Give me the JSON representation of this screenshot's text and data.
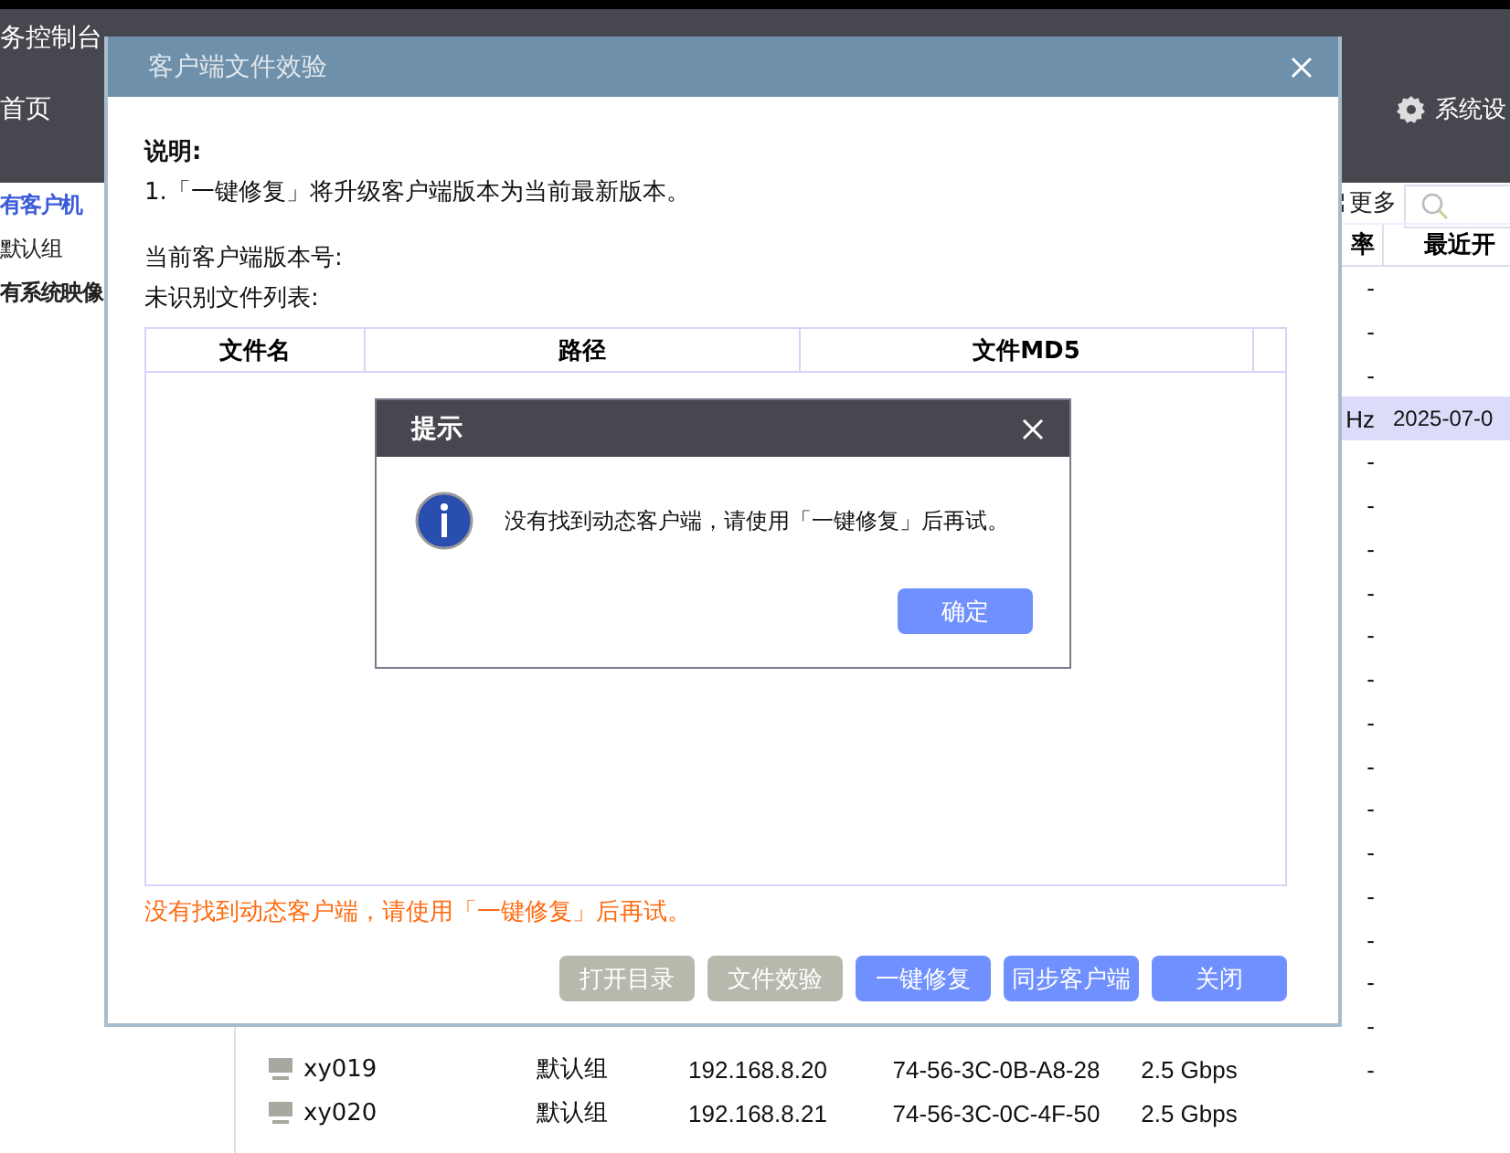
{
  "app": {
    "title": "务控制台",
    "nav": [
      {
        "label": "首页",
        "selected": false
      }
    ],
    "settings": "系统设"
  },
  "sidebar": {
    "items": [
      {
        "label": "有客户机",
        "kind": "selected"
      },
      {
        "label": "默认组",
        "kind": "plain"
      },
      {
        "label": "有系统映像",
        "kind": "heading"
      }
    ]
  },
  "toolbar": {
    "more": "更多"
  },
  "table": {
    "columns": [
      {
        "label": "率"
      },
      {
        "label": "最近开"
      }
    ],
    "rows": [
      {
        "rate": "-",
        "selected": false
      },
      {
        "rate": "-",
        "selected": false
      },
      {
        "rate": "-",
        "selected": false
      },
      {
        "rate": "Hz",
        "last": "2025-07-0",
        "selected": true
      },
      {
        "rate": "-",
        "selected": false
      },
      {
        "rate": "-",
        "selected": false
      },
      {
        "rate": "-",
        "selected": false
      },
      {
        "rate": "-",
        "selected": false
      },
      {
        "rate": "-",
        "selected": false
      },
      {
        "rate": "-",
        "selected": false
      },
      {
        "rate": "-",
        "selected": false
      },
      {
        "rate": "-",
        "selected": false
      },
      {
        "rate": "-",
        "selected": false
      },
      {
        "rate": "-",
        "selected": false
      },
      {
        "rate": "-",
        "selected": false
      },
      {
        "rate": "-",
        "selected": false
      },
      {
        "rate": "-",
        "selected": false
      },
      {
        "rate": "-",
        "selected": false
      },
      {
        "name": "xy019",
        "group": "默认组",
        "ip": "192.168.8.20",
        "mac": "74-56-3C-0B-A8-28",
        "speed": "2.5 Gbps",
        "rate": "-",
        "selected": false
      },
      {
        "name": "xy020",
        "group": "默认组",
        "ip": "192.168.8.21",
        "mac": "74-56-3C-0C-4F-50",
        "speed": "2.5 Gbps",
        "selected": false
      }
    ]
  },
  "verify_dialog": {
    "title": "客户端文件效验",
    "note_label": "说明:",
    "note": "1.「一键修复」将升级客户端版本为当前最新版本。",
    "version_label": "当前客户端版本号:",
    "list_label": "未识别文件列表:",
    "columns": [
      "文件名",
      "路径",
      "文件MD5"
    ],
    "error": "没有找到动态客户端，请使用「一键修复」后再试。",
    "buttons": [
      {
        "label": "打开目录",
        "disabled": true
      },
      {
        "label": "文件效验",
        "disabled": true
      },
      {
        "label": "一键修复",
        "disabled": false
      },
      {
        "label": "同步客户端",
        "disabled": false
      },
      {
        "label": "关闭",
        "disabled": false
      }
    ]
  },
  "prompt": {
    "title": "提示",
    "message": "没有找到动态客户端，请使用「一键修复」后再试。",
    "ok": "确定"
  }
}
